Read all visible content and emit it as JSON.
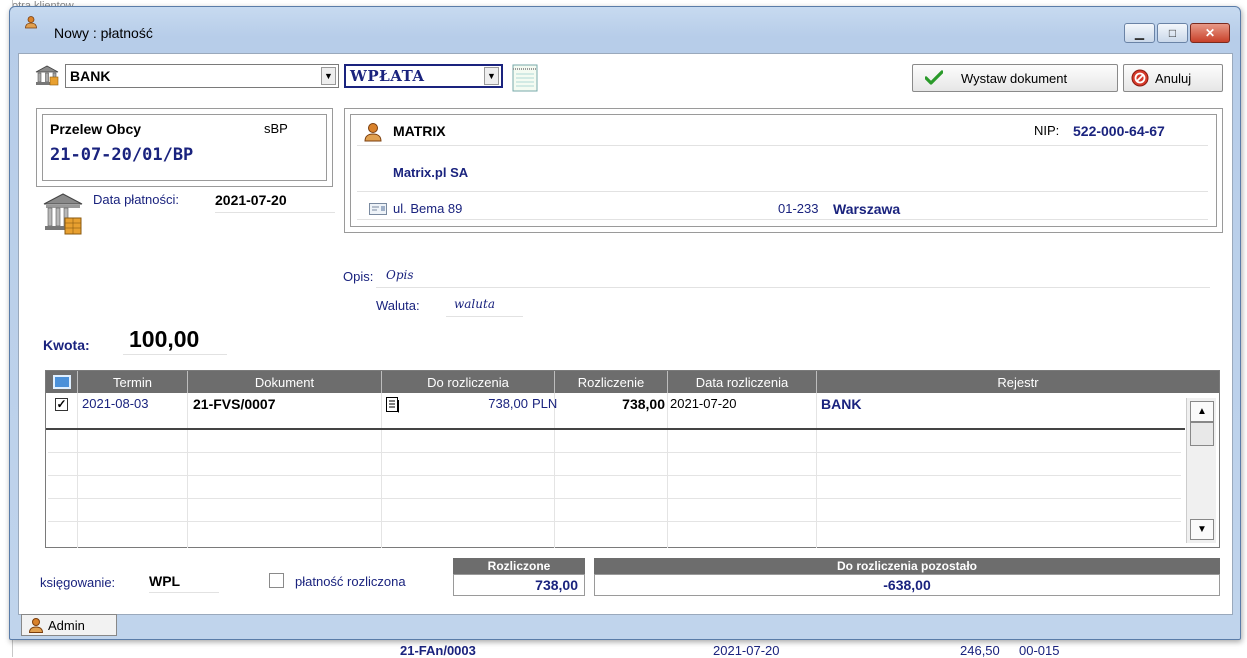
{
  "window": {
    "title": "Nowy : płatność",
    "minimize_symbol": "▁",
    "maximize_symbol": "□",
    "close_symbol": "✕"
  },
  "toolbar": {
    "account_value": "BANK",
    "type_value": "WPŁATA",
    "issue_label": "Wystaw dokument",
    "cancel_label": "Anuluj"
  },
  "document": {
    "type_label": "Przelew Obcy",
    "series": "sBP",
    "number": "21-07-20/01/BP",
    "payment_date_label": "Data płatności:",
    "payment_date": "2021-07-20"
  },
  "contractor": {
    "short_name": "MATRIX",
    "nip_label": "NIP:",
    "nip": "522-000-64-67",
    "full_name": "Matrix.pl SA",
    "street": "ul. Bema 89",
    "postcode": "01-233",
    "city": "Warszawa"
  },
  "details": {
    "description_label": "Opis:",
    "description_placeholder": "Opis",
    "currency_label": "Waluta:",
    "currency_placeholder": "waluta",
    "amount_label": "Kwota:",
    "amount": "100,00"
  },
  "table": {
    "columns": [
      "Termin",
      "Dokument",
      "Do rozliczenia",
      "Rozliczenie",
      "Data rozliczenia",
      "Rejestr"
    ],
    "rows": [
      {
        "checked": true,
        "termin": "2021-08-03",
        "dokument": "21-FVS/0007",
        "do_rozliczenia": "738,00",
        "currency": "PLN",
        "rozliczenie": "738,00",
        "data_rozliczenia": "2021-07-20",
        "rejestr": "BANK"
      }
    ]
  },
  "footer": {
    "posting_label": "księgowanie:",
    "posting_value": "WPL",
    "settled_checkbox_label": "płatność rozliczona",
    "settled_header": "Rozliczone",
    "settled_value": "738,00",
    "remaining_header": "Do rozliczenia pozostało",
    "remaining_value": "-638,00"
  },
  "statusbar": {
    "user_label": "Admin"
  },
  "background": {
    "top_text": "otra klientow",
    "bottom_doc": "21-FAn/0003",
    "bottom_date": "2021-07-20",
    "bottom_amount": "246,50",
    "bottom_code": "00-015"
  },
  "colors": {
    "accent_navy": "#1a237e",
    "grid_header": "#6d6d6d",
    "close_red": "#c8412a"
  }
}
